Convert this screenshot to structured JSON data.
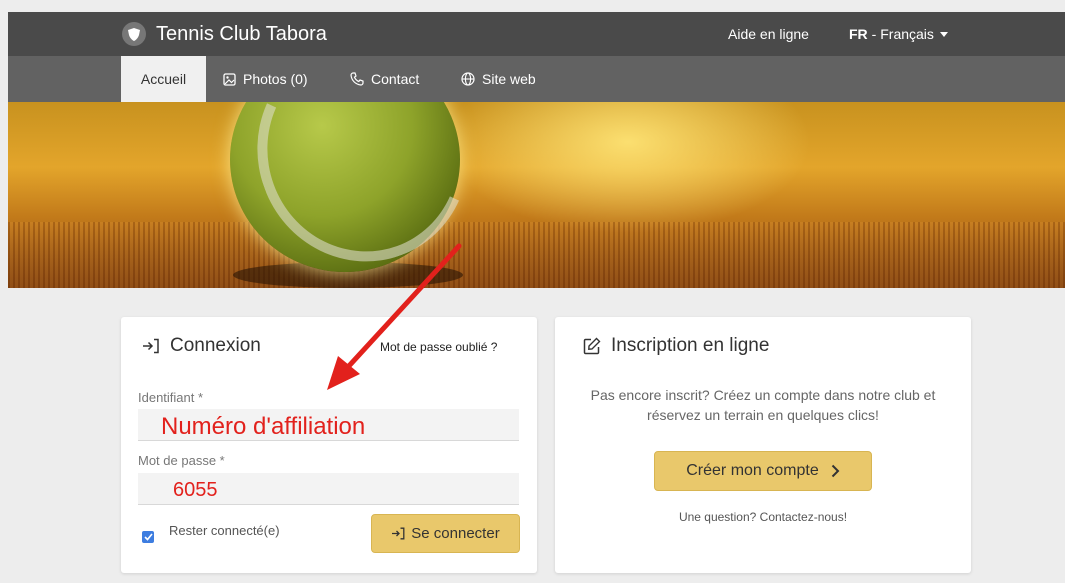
{
  "header": {
    "brand_icon": "shield-icon",
    "title": "Tennis Club Tabora",
    "help_label": "Aide en ligne",
    "lang_code": "FR",
    "lang_name": "- Français"
  },
  "nav": {
    "tabs": [
      {
        "label": "Accueil",
        "icon": "",
        "active": true
      },
      {
        "label": "Photos (0)",
        "icon": "image-icon"
      },
      {
        "label": "Contact",
        "icon": "phone-icon"
      },
      {
        "label": "Site web",
        "icon": "globe-icon"
      }
    ]
  },
  "login": {
    "title": "Connexion",
    "forgot_label": "Mot de passe oublié ?",
    "username_label": "Identifiant *",
    "username_value": "Numéro d'affiliation",
    "password_label": "Mot de passe *",
    "password_value": "6055",
    "remember_label": "Rester connecté(e)",
    "remember_checked": true,
    "submit_label": "Se connecter"
  },
  "signup": {
    "title": "Inscription en ligne",
    "text_line1": "Pas encore inscrit? Créez un compte dans notre club et",
    "text_line2": "réservez un terrain en quelques clics!",
    "create_label": "Créer mon compte",
    "question": "Une question? Contactez-nous!"
  },
  "colors": {
    "topbar": "#4a4a4a",
    "navbar": "#626262",
    "accent_button": "#e9c86b",
    "annotation_red": "#e2211c",
    "checkbox_blue": "#3d7de0"
  }
}
